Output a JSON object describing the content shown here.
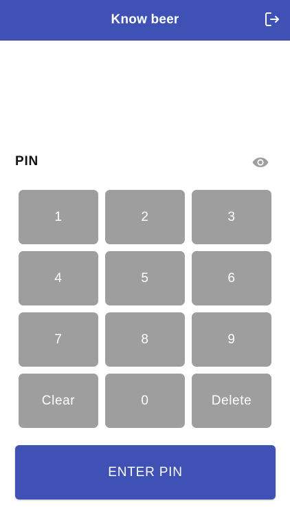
{
  "header": {
    "title": "Know beer",
    "logout_icon": "logout-icon",
    "background_color": "#3f51b5"
  },
  "pin": {
    "label": "PIN",
    "value": "",
    "visibility_icon": "eye-icon"
  },
  "keypad": {
    "key_color": "#9e9e9e",
    "keys": [
      {
        "label": "1"
      },
      {
        "label": "2"
      },
      {
        "label": "3"
      },
      {
        "label": "4"
      },
      {
        "label": "5"
      },
      {
        "label": "6"
      },
      {
        "label": "7"
      },
      {
        "label": "8"
      },
      {
        "label": "9"
      },
      {
        "label": "Clear"
      },
      {
        "label": "0"
      },
      {
        "label": "Delete"
      }
    ]
  },
  "actions": {
    "enter_label": "ENTER PIN",
    "enter_color": "#3f51b5"
  }
}
